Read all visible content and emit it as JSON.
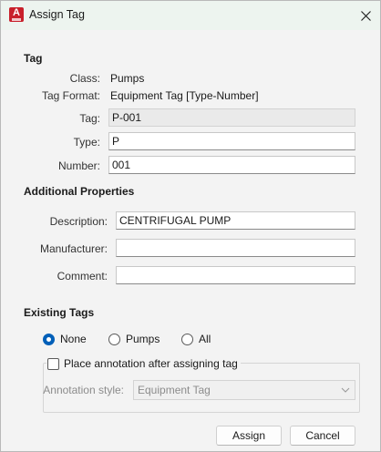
{
  "window": {
    "title": "Assign Tag",
    "app_icon_letter": "A"
  },
  "tag": {
    "section_title": "Tag",
    "class_label": "Class:",
    "class_value": "Pumps",
    "format_label": "Tag Format:",
    "format_value": "Equipment Tag [Type-Number]",
    "tag_label": "Tag:",
    "tag_value": "P-001",
    "type_label": "Type:",
    "type_value": "P",
    "number_label": "Number:",
    "number_value": "001"
  },
  "additional": {
    "section_title": "Additional Properties",
    "description_label": "Description:",
    "description_value": "CENTRIFUGAL PUMP",
    "manufacturer_label": "Manufacturer:",
    "manufacturer_value": "",
    "comment_label": "Comment:",
    "comment_value": ""
  },
  "existing": {
    "section_title": "Existing Tags",
    "options": [
      {
        "label": "None",
        "selected": true
      },
      {
        "label": "Pumps",
        "selected": false
      },
      {
        "label": "All",
        "selected": false
      }
    ],
    "place_annotation_label": "Place annotation after assigning tag",
    "place_annotation_checked": false,
    "annotation_style_label": "Annotation style:",
    "annotation_style_value": "Equipment Tag"
  },
  "buttons": {
    "assign": "Assign",
    "cancel": "Cancel"
  },
  "colors": {
    "accent": "#005fb8",
    "titlebar": "#edf4ef",
    "app_icon": "#c8202b"
  }
}
